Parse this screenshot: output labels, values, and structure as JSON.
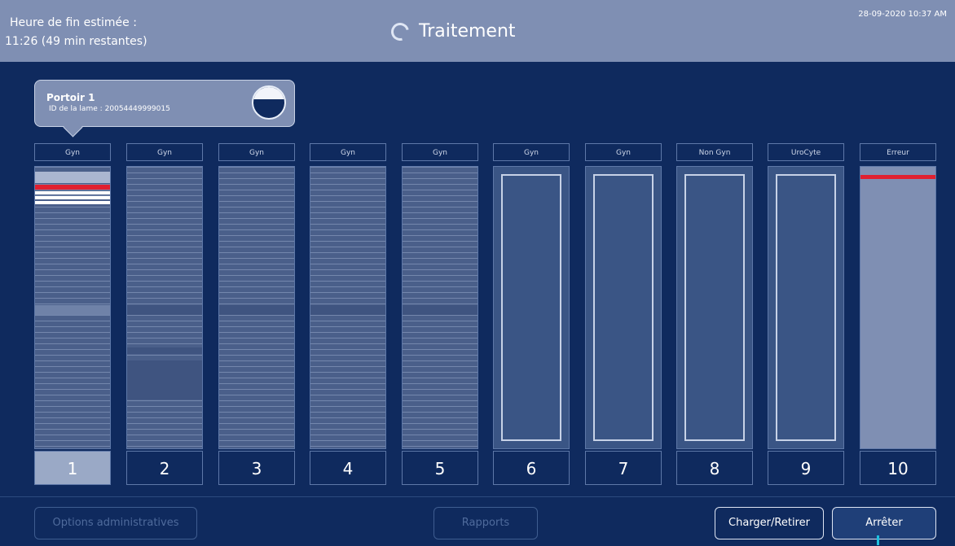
{
  "header": {
    "eta_label": "Heure de fin estimée :",
    "eta_value": "11:26 (49 min restantes)",
    "title": "Traitement",
    "datetime": "28-09-2020 10:37 AM"
  },
  "tooltip": {
    "title": "Portoir 1",
    "id_label": "ID de la lame :",
    "id_value": "20054449999015"
  },
  "racks": [
    {
      "number": "1",
      "label": "Gyn",
      "state": "selected"
    },
    {
      "number": "2",
      "label": "Gyn",
      "state": "loaded"
    },
    {
      "number": "3",
      "label": "Gyn",
      "state": "loaded"
    },
    {
      "number": "4",
      "label": "Gyn",
      "state": "loaded"
    },
    {
      "number": "5",
      "label": "Gyn",
      "state": "loaded"
    },
    {
      "number": "6",
      "label": "Gyn",
      "state": "empty"
    },
    {
      "number": "7",
      "label": "Gyn",
      "state": "empty"
    },
    {
      "number": "8",
      "label": "Non Gyn",
      "state": "empty"
    },
    {
      "number": "9",
      "label": "UroCyte",
      "state": "empty"
    },
    {
      "number": "10",
      "label": "Erreur",
      "state": "error"
    }
  ],
  "buttons": {
    "admin": "Options administratives",
    "reports": "Rapports",
    "load": "Charger/Retirer",
    "stop": "Arrêter"
  },
  "colors": {
    "background": "#0f2a5e",
    "header": "#7f8fb3",
    "error_red": "#e02030",
    "highlight_white": "#ffffff"
  }
}
